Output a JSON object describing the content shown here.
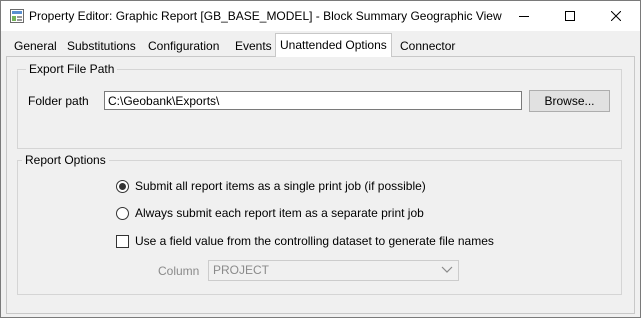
{
  "window": {
    "title": "Property Editor: Graphic Report [GB_BASE_MODEL] - Block Summary Geographic View"
  },
  "tabs": [
    {
      "label": "General",
      "active": false
    },
    {
      "label": "Substitutions",
      "active": false
    },
    {
      "label": "Configuration",
      "active": false
    },
    {
      "label": "Events",
      "active": false
    },
    {
      "label": "Unattended Options",
      "active": true
    },
    {
      "label": "Connector",
      "active": false
    }
  ],
  "export_file_path": {
    "legend": "Export File Path",
    "folder_label": "Folder path",
    "folder_value": "C:\\Geobank\\Exports\\",
    "browse_label": "Browse..."
  },
  "report_options": {
    "legend": "Report Options",
    "radio_single": {
      "label": "Submit all report items as a single print job (if possible)",
      "checked": true
    },
    "radio_separate": {
      "label": "Always submit each report item as a separate print job",
      "checked": false
    },
    "checkbox_field": {
      "label": "Use a field value from the controlling dataset to generate file names",
      "checked": false
    },
    "column_label": "Column",
    "column_value": "PROJECT"
  },
  "icons": {
    "app": "report-app-icon",
    "minimize": "minimize-icon",
    "maximize": "maximize-icon",
    "close": "close-icon",
    "dropdown": "chevron-down-icon"
  }
}
